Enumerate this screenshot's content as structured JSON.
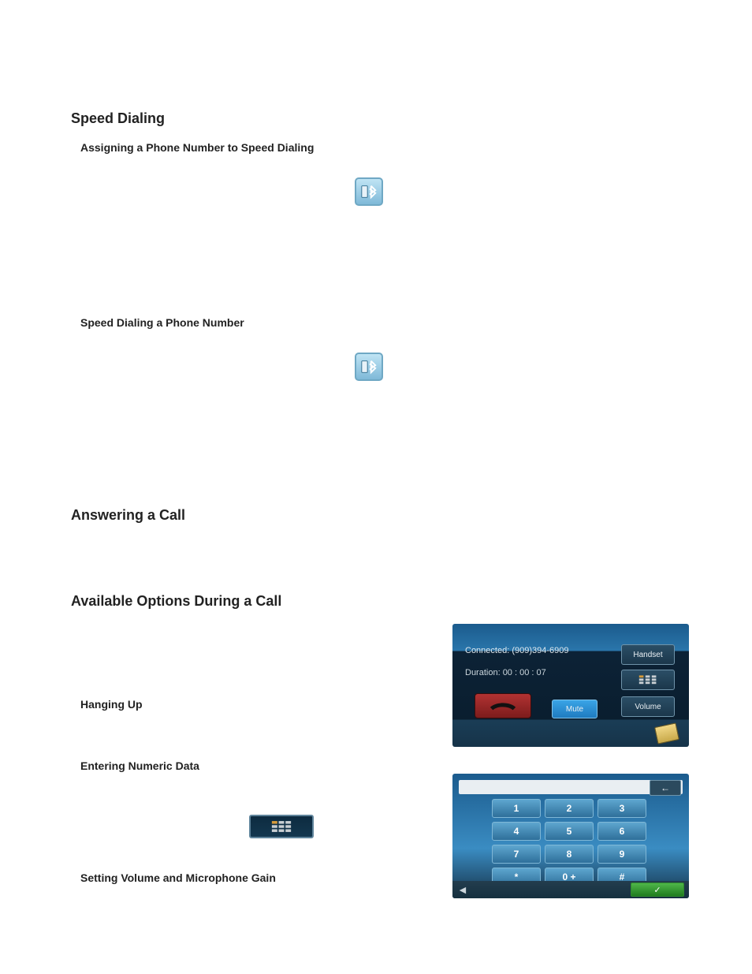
{
  "sections": {
    "speed_dialing": {
      "title": "Speed Dialing",
      "assign": {
        "title": "Assigning a Phone Number to Speed Dialing"
      },
      "dial": {
        "title": "Speed Dialing a Phone Number"
      }
    },
    "answering": {
      "title": "Answering a Call"
    },
    "options": {
      "title": "Available Options During a Call",
      "hanging": {
        "title": "Hanging Up"
      },
      "numeric": {
        "title": "Entering Numeric Data"
      },
      "volume": {
        "title": "Setting Volume and Microphone Gain"
      }
    }
  },
  "icons": {
    "bluetooth": "bluetooth-phone-icon",
    "keypad_chip": "keypad-icon"
  },
  "callscreen": {
    "connected_label": "Connected: (909)394-6909",
    "duration_label": "Duration: 00 : 00 : 07",
    "buttons": {
      "handset": "Handset",
      "volume": "Volume",
      "mute": "Mute"
    }
  },
  "keypad": {
    "keys": [
      "1",
      "2",
      "3",
      "4",
      "5",
      "6",
      "7",
      "8",
      "9",
      "*",
      "0 +",
      "#"
    ],
    "backspace_glyph": "←",
    "back_glyph": "◄",
    "ok_glyph": "✓"
  }
}
